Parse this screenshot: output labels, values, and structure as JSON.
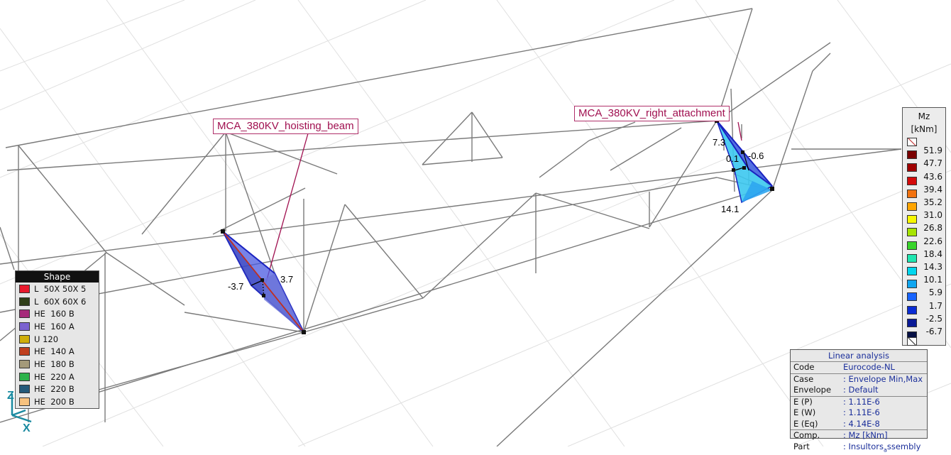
{
  "member_labels": {
    "hoisting_beam": "MCA_380KV_hoisting_beam",
    "right_attachment": "MCA_380KV_right_attachment"
  },
  "diagram_values": {
    "left_a": "-3.7",
    "left_b": "3.7",
    "right_a": "7.3",
    "right_b": "0.1",
    "right_c": "-0.6",
    "right_d": "14.1"
  },
  "shape_legend": {
    "title": "Shape",
    "items": [
      {
        "label": "L  50X 50X 5",
        "color": "#e8192c"
      },
      {
        "label": "L  60X 60X 6",
        "color": "#2f3f18"
      },
      {
        "label": "HE  160 B",
        "color": "#a62a7a"
      },
      {
        "label": "HE  160 A",
        "color": "#7b62d0"
      },
      {
        "label": "U 120",
        "color": "#cfae0a"
      },
      {
        "label": "HE  140 A",
        "color": "#c0401f"
      },
      {
        "label": "HE  180 B",
        "color": "#a49a7a"
      },
      {
        "label": "HE  220 A",
        "color": "#2bb24a"
      },
      {
        "label": "HE  220 B",
        "color": "#245a7a"
      },
      {
        "label": "HE  200 B",
        "color": "#f8c27e"
      }
    ]
  },
  "mz_scale": {
    "title": "Mz",
    "unit": "[kNm]",
    "bands": [
      {
        "value": "51.9",
        "color": "#7a0000"
      },
      {
        "value": "47.7",
        "color": "#a00000"
      },
      {
        "value": "43.6",
        "color": "#d40a0a"
      },
      {
        "value": "39.4",
        "color": "#f2720f"
      },
      {
        "value": "35.2",
        "color": "#ffa500"
      },
      {
        "value": "31.0",
        "color": "#f7f700"
      },
      {
        "value": "26.8",
        "color": "#a6e400"
      },
      {
        "value": "22.6",
        "color": "#38d42a"
      },
      {
        "value": "18.4",
        "color": "#1fe6b0"
      },
      {
        "value": "14.3",
        "color": "#00d6ee"
      },
      {
        "value": "10.1",
        "color": "#0fa6f0"
      },
      {
        "value": "5.9",
        "color": "#1864ff"
      },
      {
        "value": "1.7",
        "color": "#0a2cd4"
      },
      {
        "value": "-2.5",
        "color": "#0a1a96"
      },
      {
        "value": "-6.7",
        "color": "#061044"
      }
    ]
  },
  "analysis": {
    "title": "Linear analysis",
    "rows": [
      {
        "key": "Code",
        "value": "Eurocode-NL"
      },
      {
        "key": "Case",
        "value": ": Envelope Min,Max"
      },
      {
        "key": "Envelope",
        "value": ": Default"
      },
      {
        "key": "E (P)",
        "value": ": 1.11E-6"
      },
      {
        "key": "E (W)",
        "value": ": 1.11E-6"
      },
      {
        "key": "E (Eq)",
        "value": ": 4.14E-8"
      },
      {
        "key": "Comp.",
        "value": ": Mz [kNm]"
      },
      {
        "key": "Part",
        "value": ": Insultors"
      },
      {
        "key": "Part_sub",
        "value": "a"
      },
      {
        "key": "Part_tail",
        "value": "ssembly"
      }
    ]
  },
  "axes": {
    "z_label": "Z",
    "x_label": "X",
    "color": "#1a8aa0"
  }
}
